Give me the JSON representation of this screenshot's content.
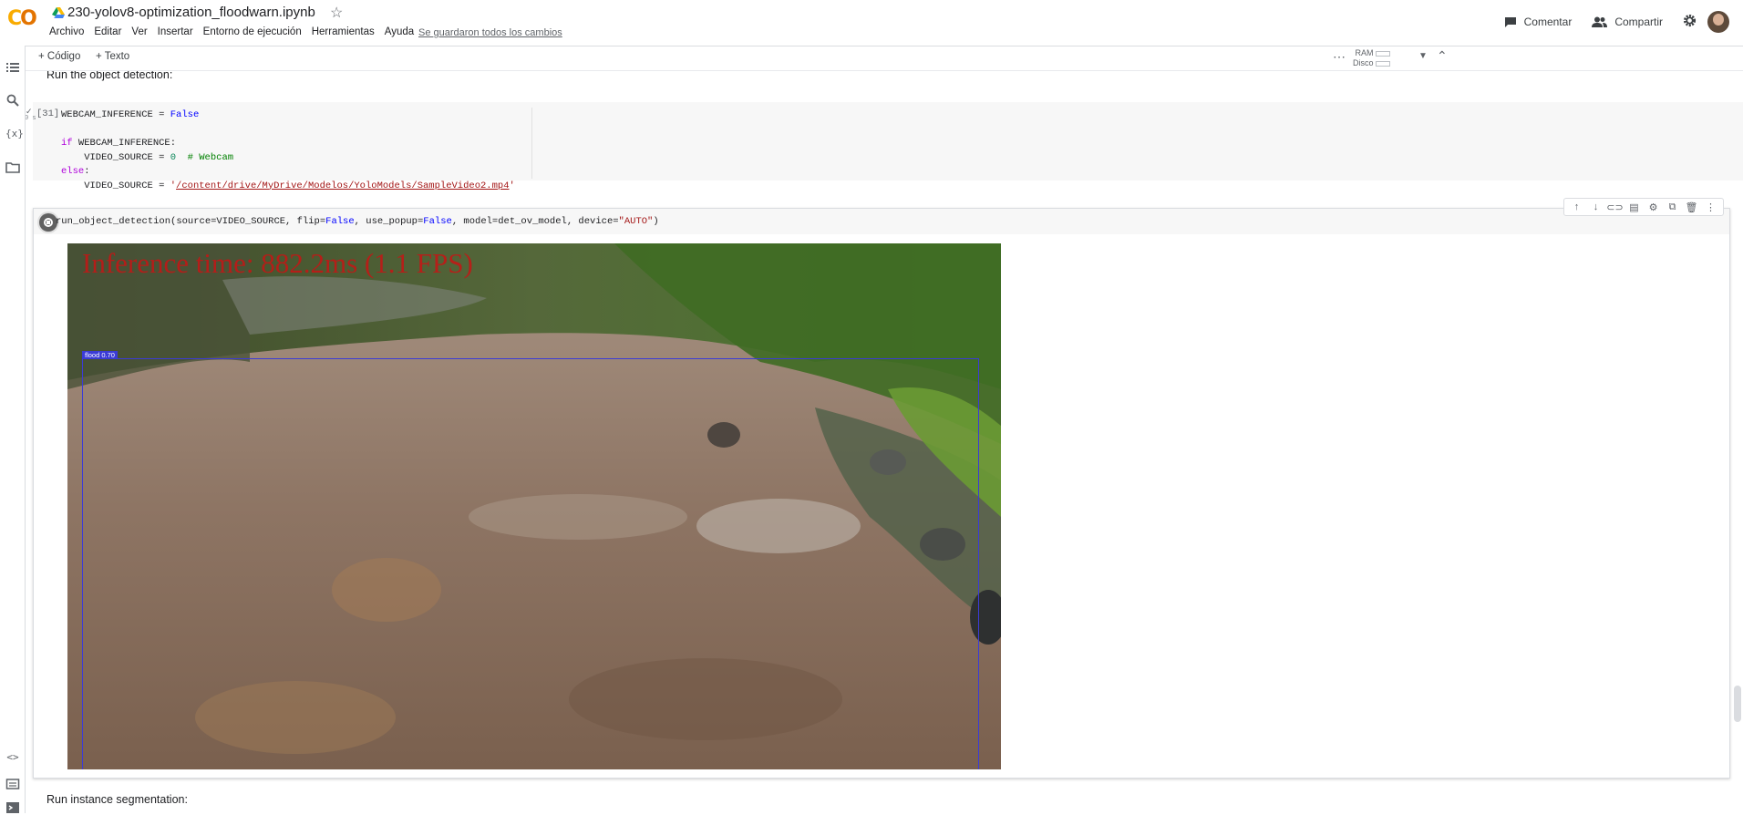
{
  "header": {
    "title": "230-yolov8-optimization_floodwarn.ipynb",
    "menu": [
      "Archivo",
      "Editar",
      "Ver",
      "Insertar",
      "Entorno de ejecución",
      "Herramientas",
      "Ayuda"
    ],
    "saved_status": "Se guardaron todos los cambios",
    "comment_label": "Comentar",
    "share_label": "Compartir"
  },
  "toolbar": {
    "add_code": "+ Código",
    "add_text": "+ Texto",
    "ram_label": "RAM",
    "disk_label": "Disco"
  },
  "cells": {
    "text1": "Run the object detection:",
    "code1": {
      "exec_count": "[31]",
      "status_time": "0 s",
      "lines": [
        "WEBCAM_INFERENCE = False",
        "",
        "if WEBCAM_INFERENCE:",
        "    VIDEO_SOURCE = 0  # Webcam",
        "else:",
        "    VIDEO_SOURCE = '/content/drive/MyDrive/Modelos/YoloModels/SampleVideo2.mp4'"
      ]
    },
    "code2": {
      "source": "run_object_detection(source=VIDEO_SOURCE, flip=False, use_popup=False, model=det_ov_model, device=\"AUTO\")"
    },
    "output": {
      "inference_text": "Inference time: 882.2ms (1.1 FPS)",
      "bbox_label": "flood  0.70"
    },
    "text2": "Run instance segmentation:"
  },
  "colors": {
    "accent_orange": "#f9ab00",
    "bbox_blue": "#3b3bd6",
    "overlay_red": "#c81414"
  },
  "icons": [
    "drive-icon",
    "star-icon",
    "comment-icon",
    "share-icon",
    "gear-icon",
    "avatar",
    "toc-icon",
    "search-icon",
    "variables-icon",
    "folder-icon",
    "code-snippets-icon",
    "terminal-icon"
  ]
}
